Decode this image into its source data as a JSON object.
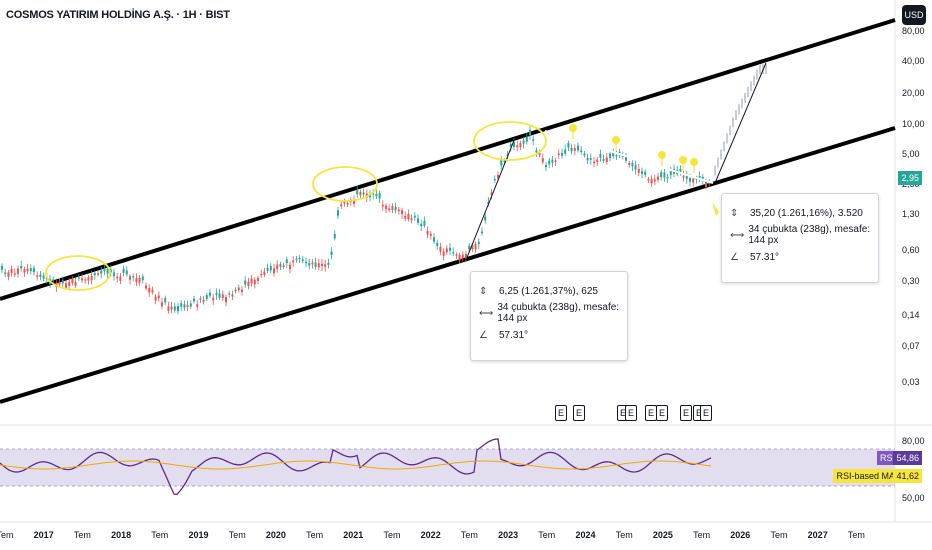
{
  "header": {
    "title": "COSMOS YATIRIM HOLDİNG A.Ş. · 1H · BIST",
    "currency_button": "USD"
  },
  "chart_data": {
    "type": "candlestick",
    "scale": "log",
    "price_axis_ticks": [
      "80,00",
      "40,00",
      "20,00",
      "10,00",
      "5,00",
      "2,50",
      "1,30",
      "0,60",
      "0,30",
      "0,14",
      "0,07",
      "0,03"
    ],
    "last_price": "2,95",
    "time_axis_ticks": [
      {
        "label": "Tem",
        "bold": false
      },
      {
        "label": "2017",
        "bold": true
      },
      {
        "label": "Tem",
        "bold": false
      },
      {
        "label": "2018",
        "bold": true
      },
      {
        "label": "Tem",
        "bold": false
      },
      {
        "label": "2019",
        "bold": true
      },
      {
        "label": "Tem",
        "bold": false
      },
      {
        "label": "2020",
        "bold": true
      },
      {
        "label": "Tem",
        "bold": false
      },
      {
        "label": "2021",
        "bold": true
      },
      {
        "label": "Tem",
        "bold": false
      },
      {
        "label": "2022",
        "bold": true
      },
      {
        "label": "Tem",
        "bold": false
      },
      {
        "label": "2023",
        "bold": true
      },
      {
        "label": "Tem",
        "bold": false
      },
      {
        "label": "2024",
        "bold": true
      },
      {
        "label": "Tem",
        "bold": false
      },
      {
        "label": "2025",
        "bold": true
      },
      {
        "label": "Tem",
        "bold": false
      },
      {
        "label": "2026",
        "bold": true
      },
      {
        "label": "Tem",
        "bold": false
      },
      {
        "label": "2027",
        "bold": true
      },
      {
        "label": "Tem",
        "bold": false
      }
    ],
    "earnings_markers": [
      "E",
      "E",
      "E",
      "E",
      "E",
      "E",
      "E",
      "E",
      "E"
    ],
    "measure_boxes": [
      {
        "change": "6,25 (1.261,37%), 625",
        "bars": "34 çubukta (238g), mesafe: 144 px",
        "angle": "57.31°"
      },
      {
        "change": "35,20 (1.261,16%), 3.520",
        "bars": "34 çubukta (238g), mesafe: 144 px",
        "angle": "57.31°"
      }
    ],
    "rsi": {
      "axis_ticks": [
        "80,00",
        "50,00"
      ],
      "label": "RSI",
      "value": "54,86",
      "ma_label": "RSI-based MA",
      "ma_value": "41,62",
      "band_upper": 70,
      "band_lower": 30
    },
    "colors": {
      "up": "#26a69a",
      "down": "#ef5350",
      "channel": "#000000",
      "highlight": "#f7e53b",
      "rsi": "#5b2c8a",
      "rsi_ma": "#f2a900",
      "rsi_band": "#e3ddf0"
    }
  }
}
